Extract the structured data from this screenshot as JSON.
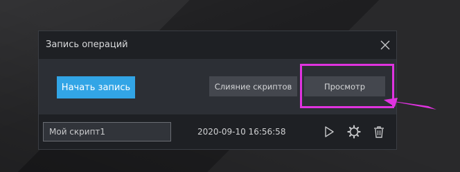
{
  "dialog": {
    "title": "Запись операций",
    "close_icon": "close-icon"
  },
  "toolbar": {
    "start_label": "Начать запись",
    "merge_label": "Слияние скриптов",
    "preview_label": "Просмотр"
  },
  "script": {
    "name": "Мой скрипт1",
    "date": "2020-09-10 16:56:58",
    "icons": [
      "play-icon",
      "gear-icon",
      "trash-icon"
    ]
  },
  "colors": {
    "accent": "#32a5e6",
    "highlight": "#e033e0",
    "dialog_bg": "#1e2024",
    "toolbar_bg": "#2c2f35"
  }
}
